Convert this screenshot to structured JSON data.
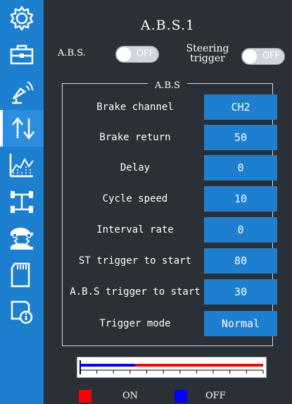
{
  "sidebar": {
    "items": [
      {
        "icon": "gear-icon"
      },
      {
        "icon": "toolbox-icon"
      },
      {
        "icon": "radar-icon"
      },
      {
        "icon": "reverse-arrows-icon",
        "active": true
      },
      {
        "icon": "curve-chart-icon"
      },
      {
        "icon": "chassis-icon"
      },
      {
        "icon": "car-swap-icon"
      },
      {
        "icon": "sd-card-icon"
      },
      {
        "icon": "info-icon"
      }
    ]
  },
  "header": {
    "title": "A.B.S.1"
  },
  "abs_toggle": {
    "label": "A.B.S.",
    "state": "OFF"
  },
  "steering_toggle": {
    "label_line1": "Steering",
    "label_line2": "trigger",
    "state": "OFF"
  },
  "section": {
    "legend": "A.B.S"
  },
  "settings": [
    {
      "label": "Brake channel",
      "value": "CH2"
    },
    {
      "label": "Brake return",
      "value": "50"
    },
    {
      "label": "Delay",
      "value": "0"
    },
    {
      "label": "Cycle speed",
      "value": "10"
    },
    {
      "label": "Interval rate",
      "value": "0"
    },
    {
      "label": "ST trigger to start",
      "value": "80"
    },
    {
      "label": "A.B.S trigger to start",
      "value": "30"
    },
    {
      "label": "Trigger mode",
      "value": "Normal"
    }
  ],
  "pulse_bar": {
    "off_fraction": 0.3
  },
  "legend": {
    "on_label": "ON",
    "off_label": "OFF"
  },
  "colors": {
    "accent": "#1d7fcf",
    "on": "#ff0000",
    "off": "#0000ff",
    "background": "#2b2f36"
  }
}
